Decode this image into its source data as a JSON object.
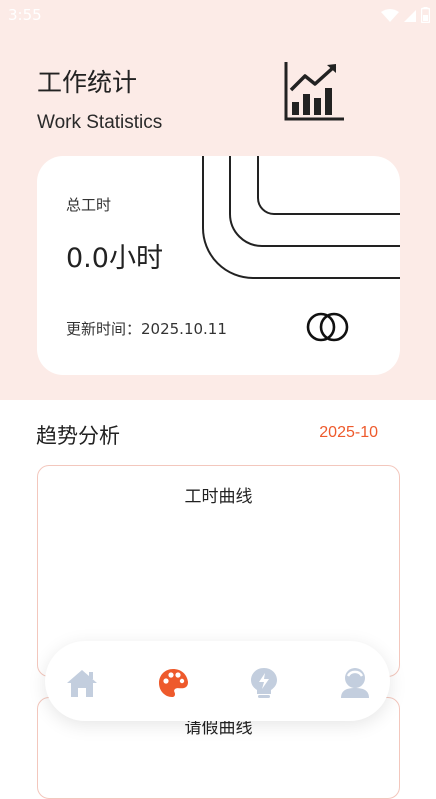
{
  "status_bar": {
    "time": "3:55"
  },
  "header": {
    "title_cn": "工作统计",
    "title_en": "Work Statistics",
    "icon": "bar-chart-trend-icon"
  },
  "stats_card": {
    "label": "总工时",
    "value": "0.0小时",
    "update_text": "更新时间：2025.10.11",
    "icon": "rings-icon"
  },
  "trend": {
    "title": "趋势分析",
    "month": "2025-10",
    "cards": [
      {
        "title": "工时曲线"
      },
      {
        "title": "请假曲线"
      }
    ]
  },
  "bottom_nav": {
    "items": [
      {
        "icon": "home-icon",
        "active": false
      },
      {
        "icon": "palette-icon",
        "active": true
      },
      {
        "icon": "bulb-icon",
        "active": false
      },
      {
        "icon": "user-icon",
        "active": false
      }
    ]
  },
  "colors": {
    "accent": "#ee5a2c",
    "header_bg": "#fcebe7",
    "nav_inactive": "#c3cede",
    "card_border": "#f3c7bd"
  }
}
